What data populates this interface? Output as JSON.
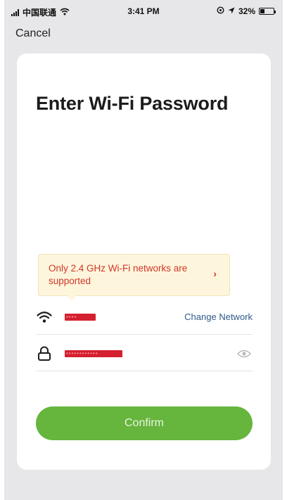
{
  "status_bar": {
    "carrier": "中国联通",
    "time": "3:41 PM",
    "battery": "32%",
    "battery_level": 0.32
  },
  "nav": {
    "cancel_label": "Cancel"
  },
  "page": {
    "title": "Enter Wi-Fi Password"
  },
  "tooltip": {
    "text": "Only 2.4 GHz Wi-Fi networks are supported"
  },
  "network": {
    "ssid_redacted": "▪▪▪▪",
    "change_label": "Change Network"
  },
  "password": {
    "value_redacted": "••••••••••••"
  },
  "actions": {
    "confirm_label": "Confirm"
  },
  "colors": {
    "accent_green": "#66b53d",
    "tooltip_bg": "#fdf6dc",
    "tooltip_text": "#d2352a",
    "link_blue": "#2d5a8a",
    "redaction": "#d4202f"
  }
}
